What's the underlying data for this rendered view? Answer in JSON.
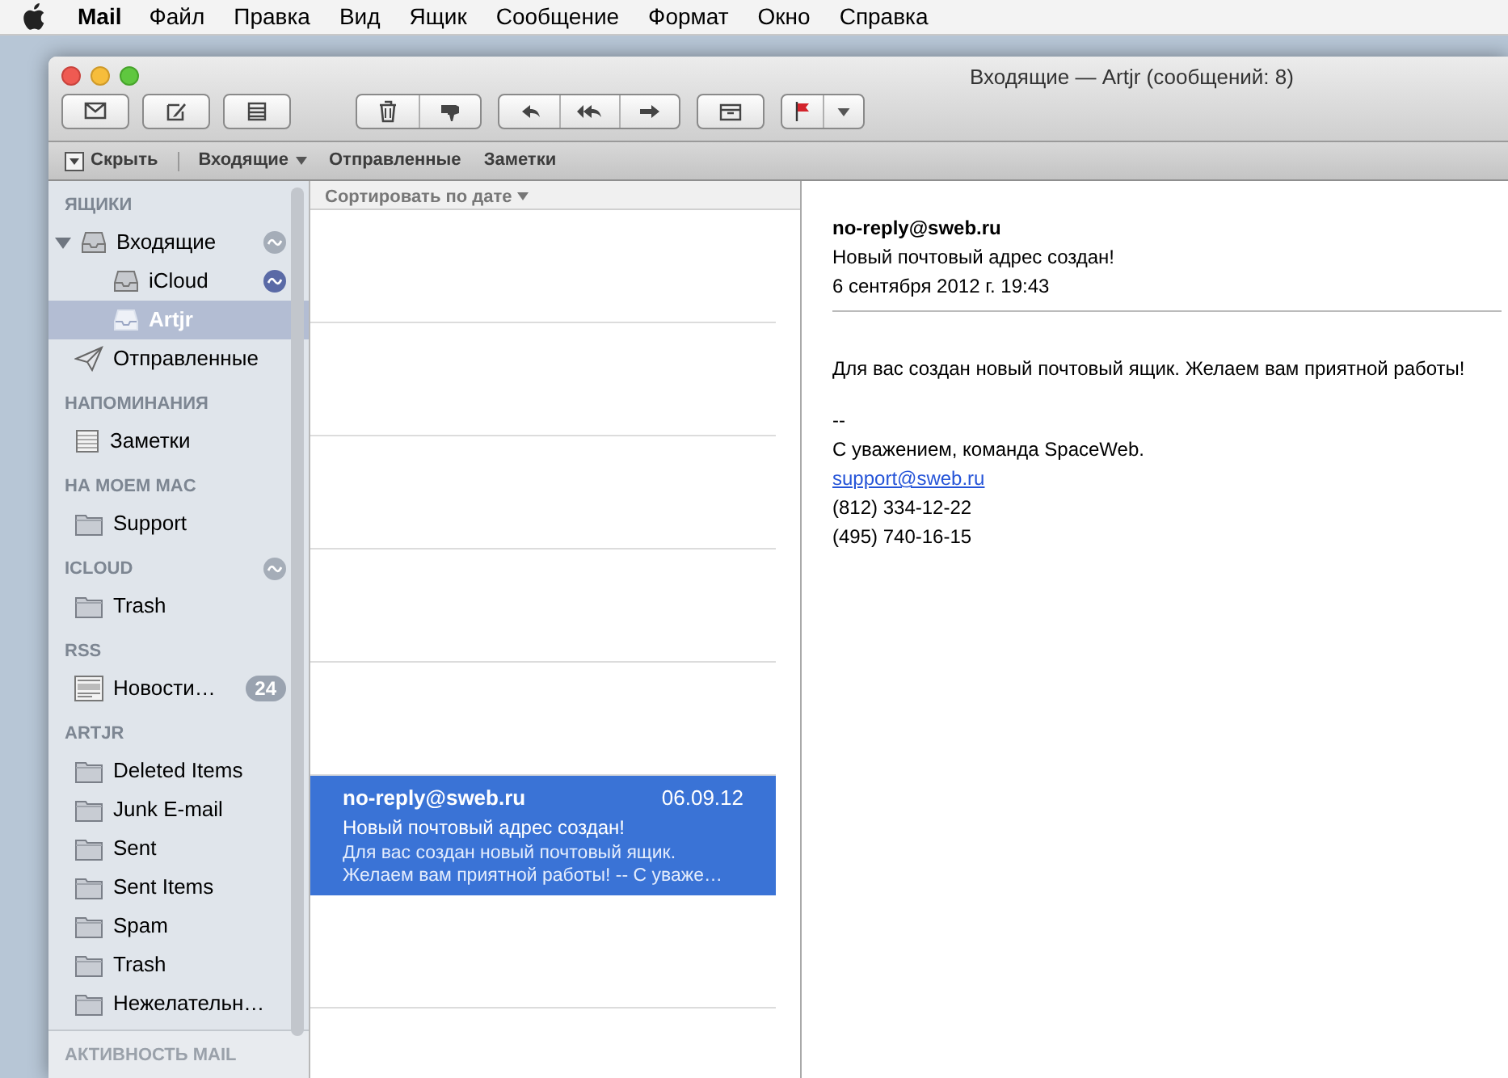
{
  "menu_bar": {
    "app": "Mail",
    "items": [
      "Файл",
      "Правка",
      "Вид",
      "Ящик",
      "Сообщение",
      "Формат",
      "Окно",
      "Справка"
    ]
  },
  "window": {
    "title": "Входящие — Artjr (сообщений: 8)"
  },
  "favorites_bar": [
    {
      "kind": "hide",
      "label": "Скрыть"
    },
    {
      "kind": "menu",
      "label": "Входящие"
    },
    {
      "kind": "plain",
      "label": "Отправленные"
    },
    {
      "kind": "plain",
      "label": "Заметки"
    }
  ],
  "sidebar": {
    "sections": [
      {
        "title": "ЯЩИКИ",
        "items": [
          {
            "label": "Входящие",
            "kind": "inbox",
            "selected": false,
            "expanded": true,
            "indicator": {
              "color": "#a5adb8"
            },
            "children": [
              {
                "label": "iCloud",
                "kind": "inbox",
                "selected": false,
                "indicator": {
                  "color": "#5a6aa6"
                }
              },
              {
                "label": "Artjr",
                "kind": "inbox",
                "selected": true
              }
            ]
          },
          {
            "label": "Отправленные",
            "kind": "sent",
            "selected": false
          }
        ]
      },
      {
        "title": "НАПОМИНАНИЯ",
        "items": [
          {
            "label": "Заметки",
            "kind": "notes",
            "selected": false
          }
        ]
      },
      {
        "title": "НА МОЕМ MAC",
        "items": [
          {
            "label": "Support",
            "kind": "folder",
            "selected": false
          }
        ]
      },
      {
        "title": "ICLOUD",
        "indicator": {
          "color": "#a5adb8"
        },
        "items": [
          {
            "label": "Trash",
            "kind": "folder",
            "selected": false
          }
        ]
      },
      {
        "title": "RSS",
        "items": [
          {
            "label": "Новости…",
            "kind": "rss",
            "selected": false,
            "badge": "24"
          }
        ]
      },
      {
        "title": "ARTJR",
        "items": [
          {
            "label": "Deleted Items",
            "kind": "folder",
            "selected": false
          },
          {
            "label": "Junk E-mail",
            "kind": "folder",
            "selected": false
          },
          {
            "label": "Sent",
            "kind": "folder",
            "selected": false
          },
          {
            "label": "Sent Items",
            "kind": "folder",
            "selected": false
          },
          {
            "label": "Spam",
            "kind": "folder",
            "selected": false
          },
          {
            "label": "Trash",
            "kind": "folder",
            "selected": false
          },
          {
            "label": "Нежелательн…",
            "kind": "folder",
            "selected": false
          }
        ]
      }
    ],
    "footer": "АКТИВНОСТЬ MAIL"
  },
  "message_list": {
    "sort_label": "Сортировать по дате",
    "messages": [
      {
        "kind": "faded",
        "selected": false
      },
      {
        "kind": "faded",
        "selected": false
      },
      {
        "kind": "faded",
        "selected": false
      },
      {
        "kind": "faded",
        "selected": false
      },
      {
        "kind": "faded",
        "selected": false
      },
      {
        "kind": "message",
        "selected": true,
        "sender": "no-reply@sweb.ru",
        "date": "06.09.12",
        "subject": "Новый почтовый адрес создан!",
        "preview": "Для вас создан новый почтовый ящик. Желаем вам приятной работы! -- С уваже…"
      },
      {
        "kind": "faded",
        "selected": false
      }
    ]
  },
  "reading_pane": {
    "from": "no-reply@sweb.ru",
    "subject": "Новый почтовый адрес создан!",
    "date": "6 сентября 2012 г. 19:43",
    "body": [
      {
        "lines": [
          {
            "kind": "text",
            "text": "Для вас создан новый почтовый ящик. Желаем вам приятной работы!"
          }
        ]
      },
      {
        "lines": [
          {
            "kind": "text",
            "text": "--"
          },
          {
            "kind": "text",
            "text": "С уважением, команда SpaceWeb."
          },
          {
            "kind": "link",
            "text": "support@sweb.ru"
          },
          {
            "kind": "text",
            "text": "(812) 334-12-22"
          },
          {
            "kind": "text",
            "text": "(495) 740-16-15"
          }
        ]
      }
    ]
  }
}
